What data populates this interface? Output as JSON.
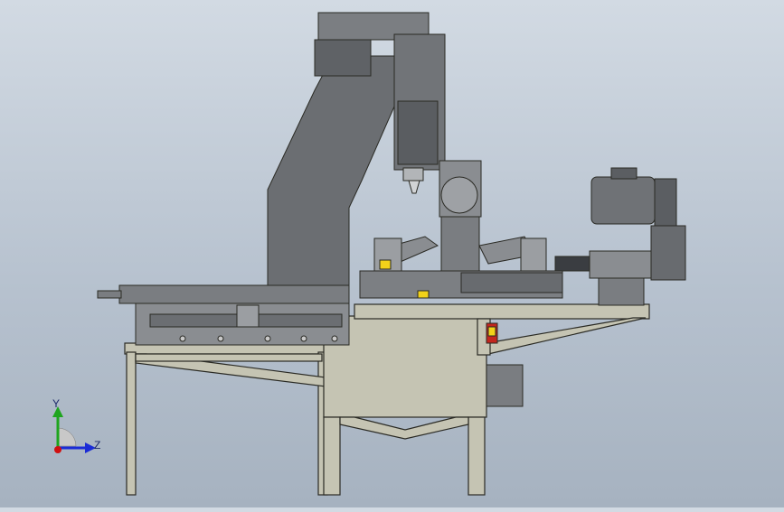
{
  "viewport": {
    "model": "cnc-milling-and-turning-station",
    "view_orientation": "right"
  },
  "triad": {
    "y_label": "Y",
    "z_label": "Z",
    "colors": {
      "y": "#1ea51e",
      "z": "#1a2bd6",
      "origin": "#d01010"
    }
  },
  "colors": {
    "frame": "#c5c4b3",
    "frame_edge": "#2a2a24",
    "machine_dark": "#6b6e72",
    "machine_mid": "#8a8d91",
    "machine_light": "#a7aaae",
    "accent_yellow": "#f2d21a",
    "accent_red": "#c3261e"
  }
}
